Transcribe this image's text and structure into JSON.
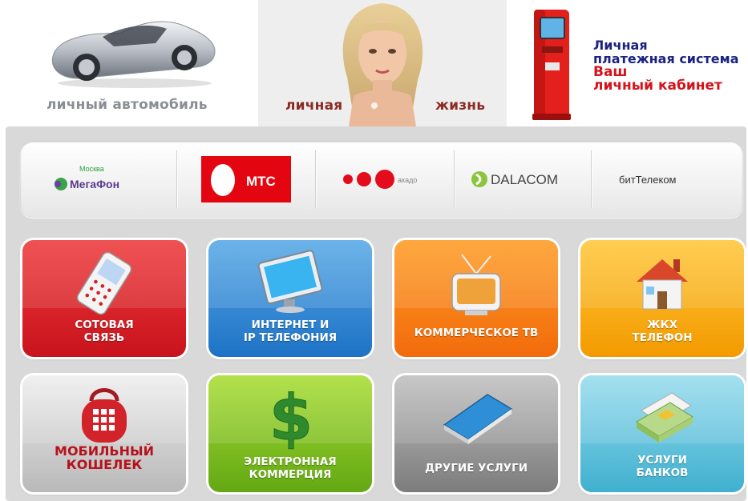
{
  "banner": {
    "car_caption": "личный автомобиль",
    "life_caption_left": "личная",
    "life_caption_right": "жизнь",
    "kiosk_line1": "Личная",
    "kiosk_line2": "платежная система",
    "kiosk_line3": "Ваш",
    "kiosk_line4": "личный кабинет"
  },
  "operators": [
    {
      "name": "МегаФон",
      "region": "Москва"
    },
    {
      "name": "МТС"
    },
    {
      "name": "акадо"
    },
    {
      "name": "DALACOM"
    },
    {
      "name": "битТелеком"
    }
  ],
  "tiles": [
    {
      "line1": "СОТОВАЯ",
      "line2": "СВЯЗЬ",
      "icon": "mobile-phone-icon",
      "color": "#d91d24"
    },
    {
      "line1": "ИНТЕРНЕТ И",
      "line2": "IP ТЕЛЕФОНИЯ",
      "icon": "monitor-icon",
      "color": "#2f86d6"
    },
    {
      "line1": "КОММЕРЧЕСКОЕ ТВ",
      "line2": "",
      "icon": "tv-icon",
      "color": "#f57d16"
    },
    {
      "line1": "ЖКХ",
      "line2": "ТЕЛЕФОН",
      "icon": "house-icon",
      "color": "#f8ac16"
    },
    {
      "line1": "МОБИЛЬНЫЙ",
      "line2": "КОШЕЛЕК",
      "icon": "wallet-icon",
      "color": "#c9c9c9"
    },
    {
      "line1": "ЭЛЕКТРОННАЯ",
      "line2": "КОММЕРЦИЯ",
      "icon": "dollar-icon",
      "color": "#80c220"
    },
    {
      "line1": "ДРУГИЕ УСЛУГИ",
      "line2": "",
      "icon": "book-icon",
      "color": "#9a9a9a"
    },
    {
      "line1": "УСЛУГИ",
      "line2": "БАНКОВ",
      "icon": "banknotes-icon",
      "color": "#67c3dd"
    }
  ]
}
